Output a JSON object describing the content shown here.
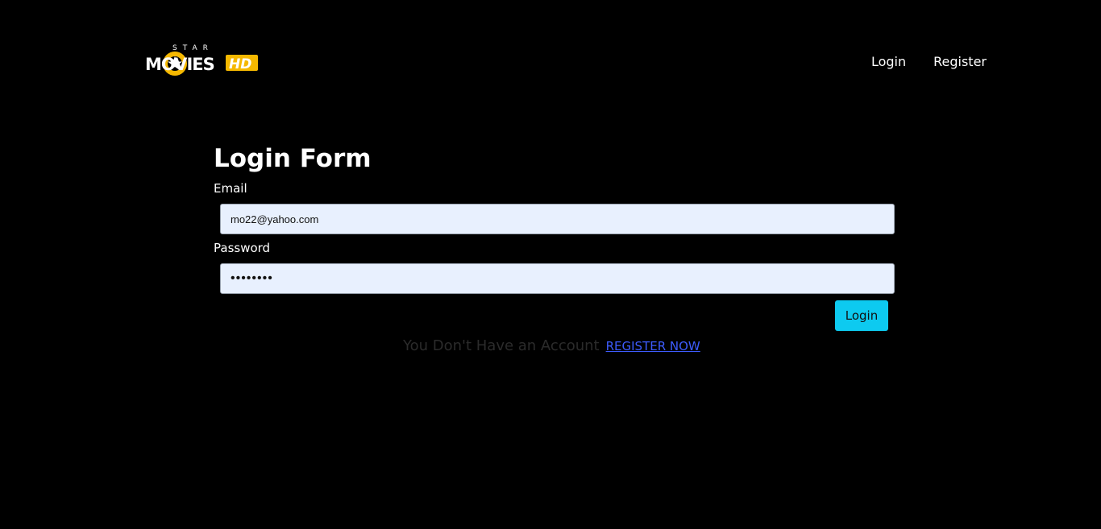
{
  "header": {
    "logo": {
      "top_text": "STAR",
      "main_text": "MOVIES",
      "badge_text": "HD",
      "accent_color": "#f5b800"
    },
    "nav": {
      "login_label": "Login",
      "register_label": "Register"
    }
  },
  "form": {
    "title": "Login Form",
    "email_label": "Email",
    "email_value": "mo22@yahoo.com",
    "password_label": "Password",
    "password_value": "12345678",
    "login_button_label": "Login",
    "no_account_text": "You Don't Have an Account",
    "register_link_label": "REGISTER NOW"
  },
  "colors": {
    "background": "#000000",
    "input_background": "#e8f0fe",
    "button": "#0dcaf0",
    "link": "#3d5cff"
  }
}
